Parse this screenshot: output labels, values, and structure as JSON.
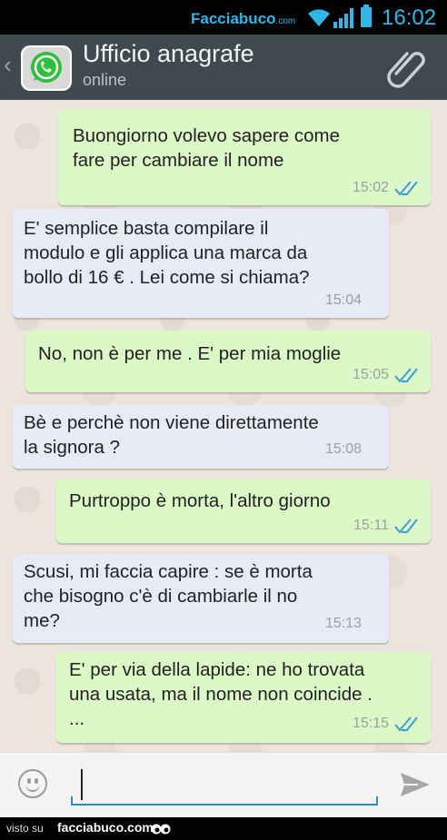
{
  "status_bar": {
    "watermark_brand": "Facciabuco",
    "watermark_tld": ".com",
    "time": "16:02",
    "icons": [
      "wifi-icon",
      "signal-icon",
      "battery-icon"
    ]
  },
  "header": {
    "back_icon": "chevron-left-icon",
    "avatar_icon": "whatsapp-icon",
    "contact_name": "Ufficio anagrafe",
    "status": "online",
    "attach_icon": "paperclip-icon"
  },
  "messages": [
    {
      "direction": "out",
      "text": "Buongiorno volevo sapere come\nfare per cambiare il nome",
      "time": "15:02",
      "read": true
    },
    {
      "direction": "in",
      "text": "E' semplice basta compilare il\nmodulo e gli applica una marca da\nbollo di 16 € . Lei come si chiama?",
      "time": "15:04"
    },
    {
      "direction": "out",
      "text": "No, non è per me . E' per mia moglie",
      "time": "15:05",
      "read": true
    },
    {
      "direction": "in",
      "text": "Bè e perchè non viene direttamente\nla signora ?",
      "time": "15:08"
    },
    {
      "direction": "out",
      "text": "Purtroppo è morta, l'altro giorno",
      "time": "15:11",
      "read": true
    },
    {
      "direction": "in",
      "text": "Scusi, mi faccia capire : se è morta\nche bisogno c'è di cambiarle il no\nme?",
      "time": "15:13"
    },
    {
      "direction": "out",
      "text": "E' per via della lapide: ne ho trovata\nuna usata, ma il nome non coincide .\n...",
      "time": "15:15",
      "read": true
    }
  ],
  "composer": {
    "value": "",
    "emoji_icon": "smiley-icon",
    "send_icon": "send-icon"
  },
  "footer": {
    "visto_su": "visto su",
    "site": "facciabuco.com"
  },
  "colors": {
    "outgoing_bubble": "#dcf8c6",
    "incoming_bubble": "#e6ebf5",
    "header": "#3f4a4f",
    "read_ticks": "#3a9bdc",
    "status_accent": "#33b5e5"
  }
}
